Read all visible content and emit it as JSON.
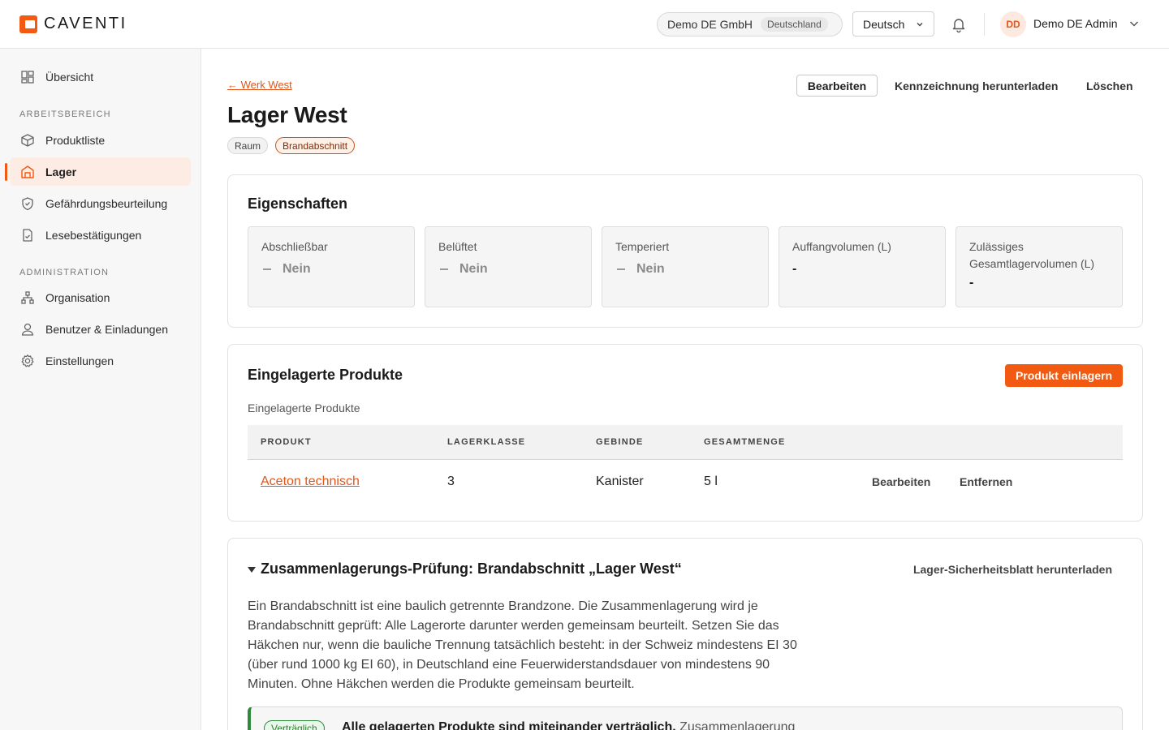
{
  "brand": {
    "name": "CAVENTI",
    "accent": "#f25a12"
  },
  "header": {
    "org_name": "Demo DE GmbH",
    "org_country": "Deutschland",
    "language": "Deutsch",
    "avatar_initials": "DD",
    "user_name": "Demo DE Admin"
  },
  "sidebar": {
    "overview": "Übersicht",
    "section_work": "ARBEITSBEREICH",
    "work_items": [
      {
        "label": "Produktliste",
        "icon": "box-icon"
      },
      {
        "label": "Lager",
        "icon": "warehouse-icon",
        "active": true
      },
      {
        "label": "Gefährdungsbeurteilung",
        "icon": "shield-icon"
      },
      {
        "label": "Lesebestätigungen",
        "icon": "document-check-icon"
      }
    ],
    "section_admin": "ADMINISTRATION",
    "admin_items": [
      {
        "label": "Organisation",
        "icon": "org-tree-icon"
      },
      {
        "label": "Benutzer & Einladungen",
        "icon": "user-icon"
      },
      {
        "label": "Einstellungen",
        "icon": "gear-icon"
      }
    ]
  },
  "page": {
    "back_link": "← Werk West",
    "title": "Lager West",
    "tags": [
      "Raum",
      "Brandabschnitt"
    ],
    "actions": {
      "edit": "Bearbeiten",
      "download_label": "Kennzeichnung herunterladen",
      "delete": "Löschen"
    }
  },
  "properties": {
    "title": "Eigenschaften",
    "items": [
      {
        "label": "Abschließbar",
        "value": "Nein"
      },
      {
        "label": "Belüftet",
        "value": "Nein"
      },
      {
        "label": "Temperiert",
        "value": "Nein"
      },
      {
        "label": "Auffangvolumen (L)",
        "value": "-"
      },
      {
        "label": "Zulässiges Gesamtlagervolumen (L)",
        "value": "-"
      }
    ]
  },
  "products": {
    "title": "Eingelagerte Produkte",
    "add_button": "Produkt einlagern",
    "sublabel": "Eingelagerte Produkte",
    "columns": [
      "PRODUKT",
      "LAGERKLASSE",
      "GEBINDE",
      "GESAMTMENGE"
    ],
    "rows": [
      {
        "product": "Aceton technisch",
        "class": "3",
        "container": "Kanister",
        "amount": "5 l",
        "edit": "Bearbeiten",
        "remove": "Entfernen"
      }
    ]
  },
  "compat": {
    "title": "Zusammenlagerungs-Prüfung: Brandabschnitt „Lager West“",
    "download": "Lager-Sicherheitsblatt herunterladen",
    "description": "Ein Brandabschnitt ist eine baulich getrennte Brandzone. Die Zusammenlagerung wird je Brandabschnitt geprüft: Alle Lagerorte darunter werden gemeinsam beurteilt. Setzen Sie das Häkchen nur, wenn die bauliche Trennung tatsächlich besteht: in der Schweiz mindestens EI 30 (über rund 1000 kg EI 60), in Deutschland eine Feuerwiderstandsdauer von mindestens 90 Minuten. Ohne Häkchen werden die Produkte gemeinsam beurteilt.",
    "badge": "Verträglich",
    "result_bold": "Alle gelagerten Produkte sind miteinander verträglich.",
    "result_rest": "Zusammenlagerung",
    "ok_color": "#2e8b3e"
  }
}
